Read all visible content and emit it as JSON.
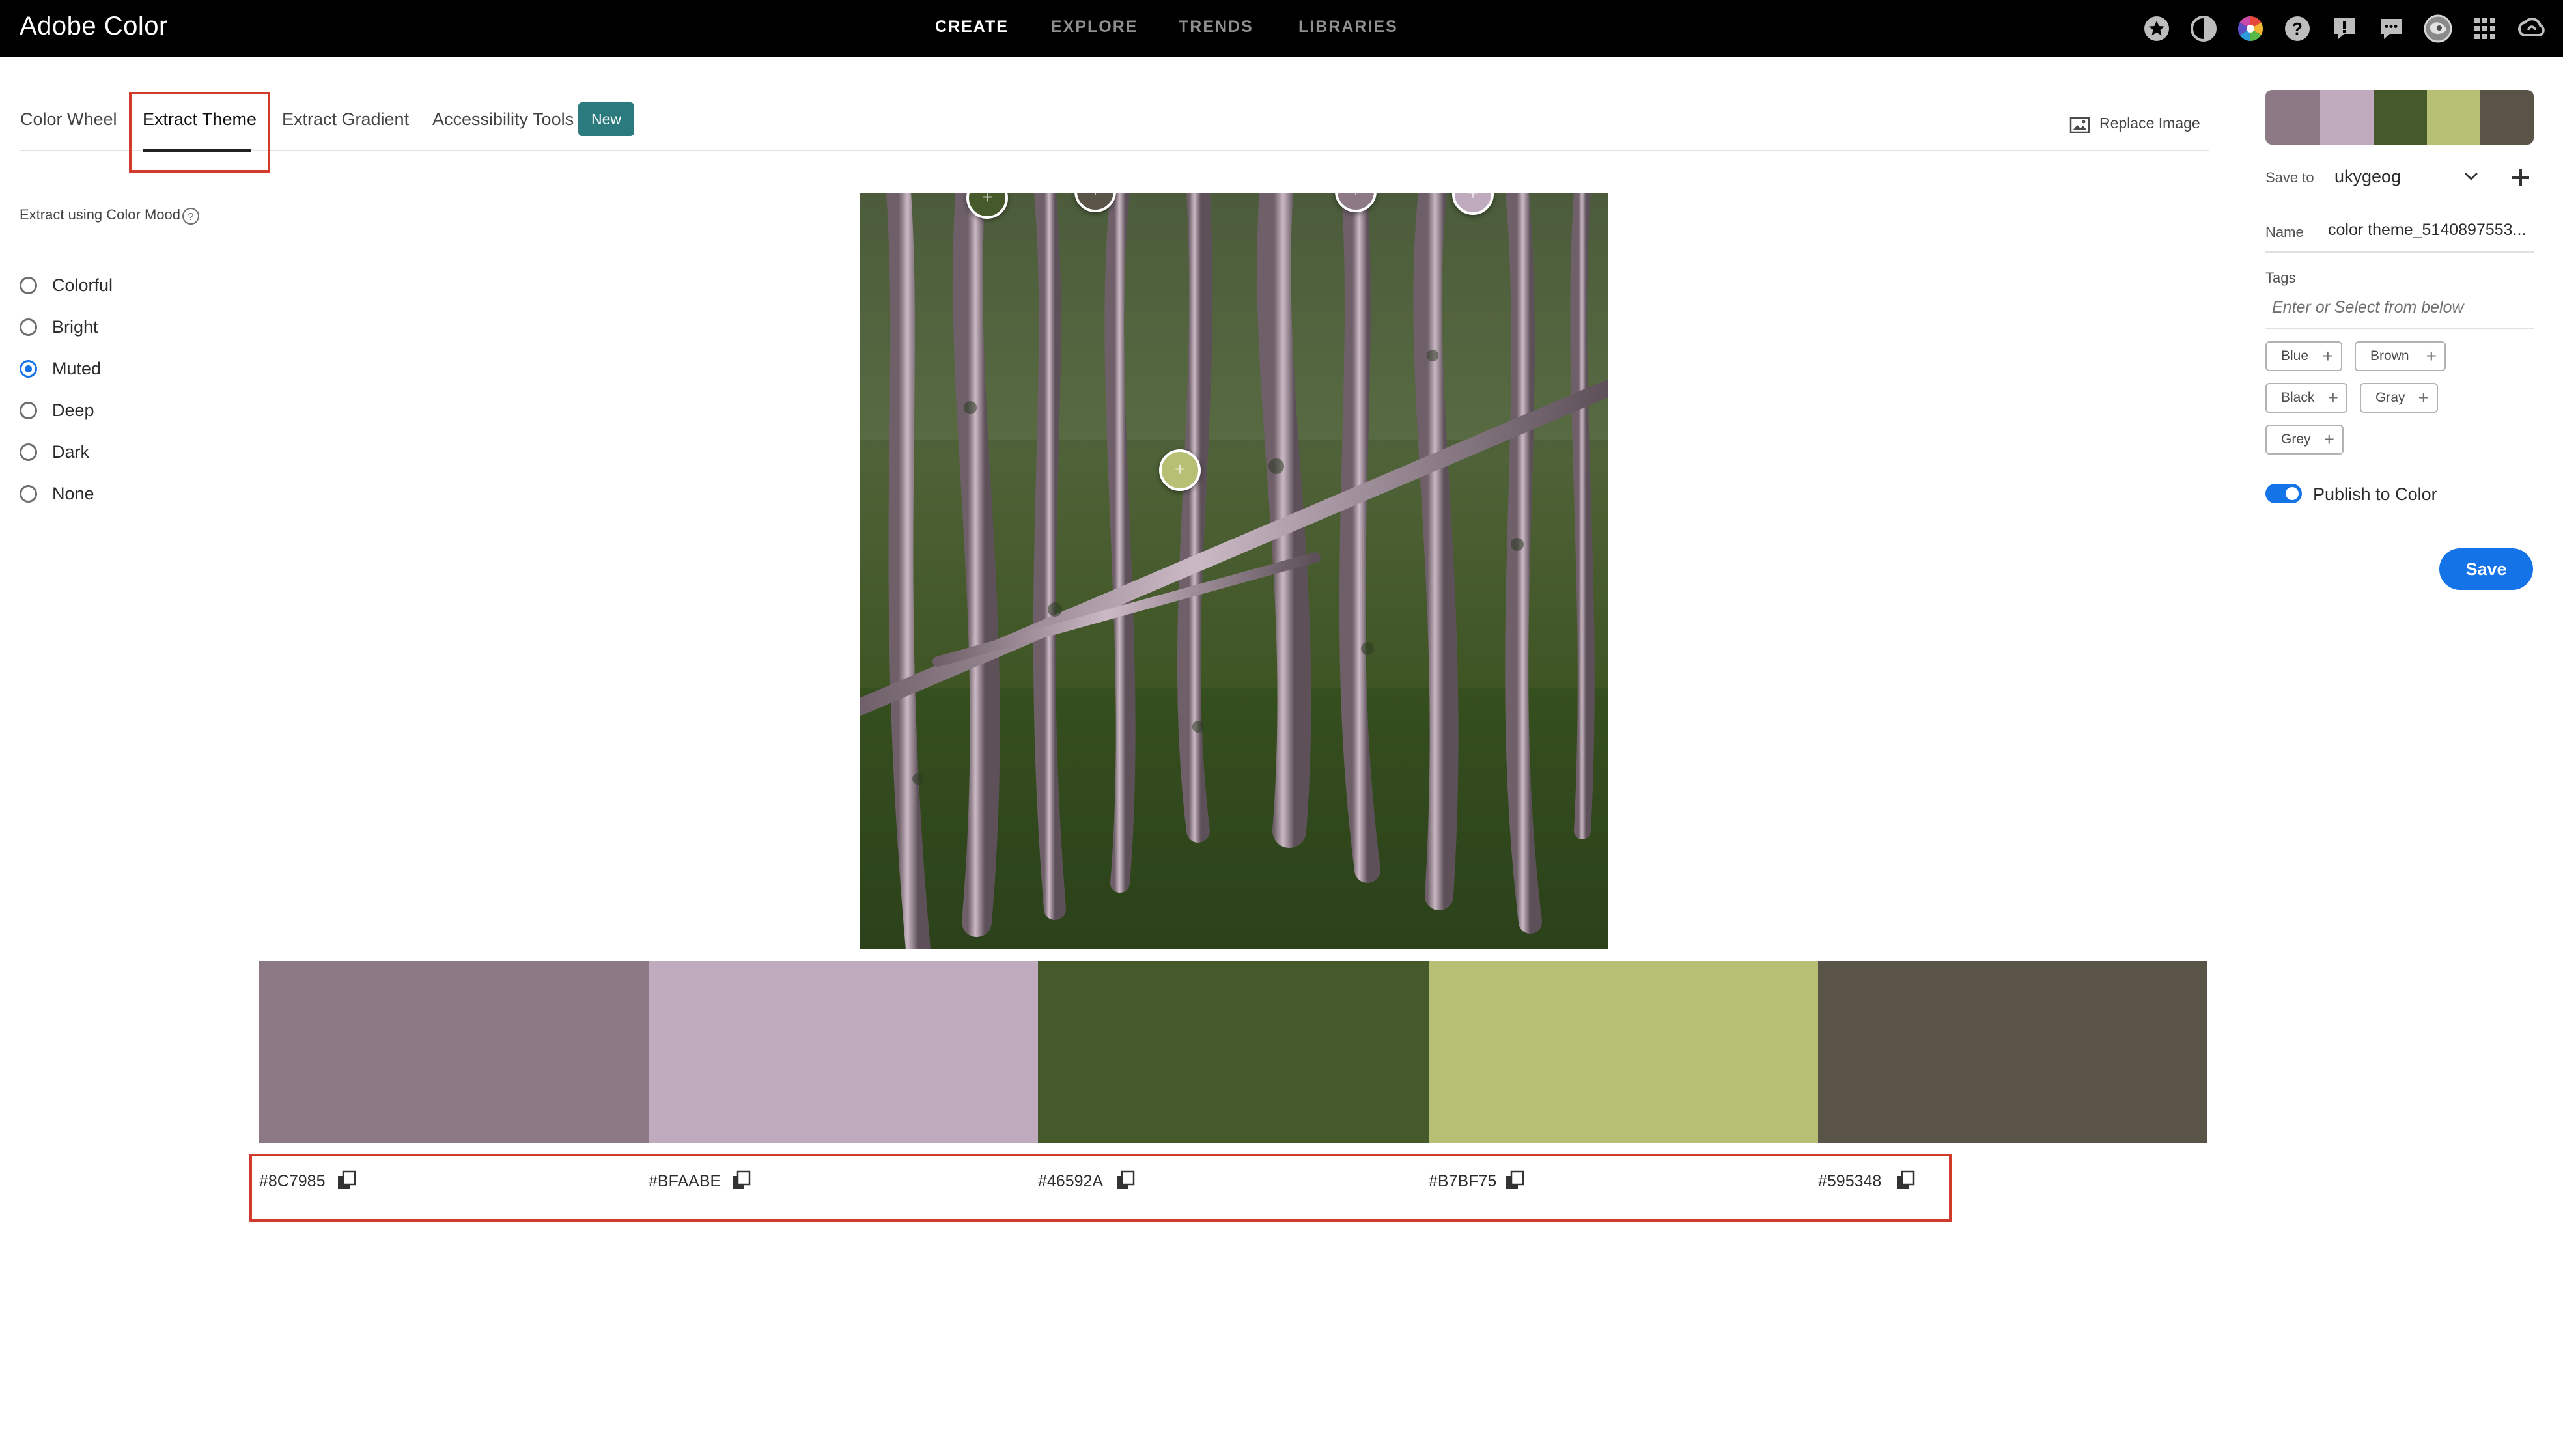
{
  "app": {
    "title": "Adobe Color"
  },
  "nav": {
    "create": "CREATE",
    "explore": "EXPLORE",
    "trends": "TRENDS",
    "libraries": "LIBRARIES",
    "active": "CREATE"
  },
  "top_icons": [
    "star-icon",
    "moon-icon",
    "color-wheel-icon",
    "help-icon",
    "feedback-icon",
    "chat-icon",
    "avatar",
    "apps-grid-icon",
    "creative-cloud-icon"
  ],
  "tabs": {
    "color_wheel": "Color Wheel",
    "extract_theme": "Extract Theme",
    "extract_gradient": "Extract Gradient",
    "accessibility_tools": "Accessibility Tools",
    "new_badge": "New",
    "active": "Extract Theme"
  },
  "replace_image": "Replace Image",
  "mood": {
    "title": "Extract using Color Mood",
    "options": [
      "Colorful",
      "Bright",
      "Muted",
      "Deep",
      "Dark",
      "None"
    ],
    "selected": "Muted"
  },
  "theme": {
    "colors": [
      "#8C7985",
      "#BFAABE",
      "#46592A",
      "#B7BF75",
      "#595348"
    ],
    "hex_labels": [
      "#8C7985",
      "#BFAABE",
      "#46592A",
      "#B7BF75",
      "#595348"
    ]
  },
  "right_panel": {
    "save_to_label": "Save to",
    "save_to_value": "ukygeog",
    "name_label": "Name",
    "name_value": "color theme_5140897553...",
    "tags_label": "Tags",
    "tags_placeholder": "Enter or Select from below",
    "tags": [
      "Blue",
      "Brown",
      "Black",
      "Gray",
      "Grey"
    ],
    "publish_label": "Publish to Color",
    "publish_on": true,
    "save_button": "Save"
  },
  "colors": {
    "accent": "#1473e6",
    "badge": "#2b7a7e",
    "annotation": "#d23a2b"
  }
}
